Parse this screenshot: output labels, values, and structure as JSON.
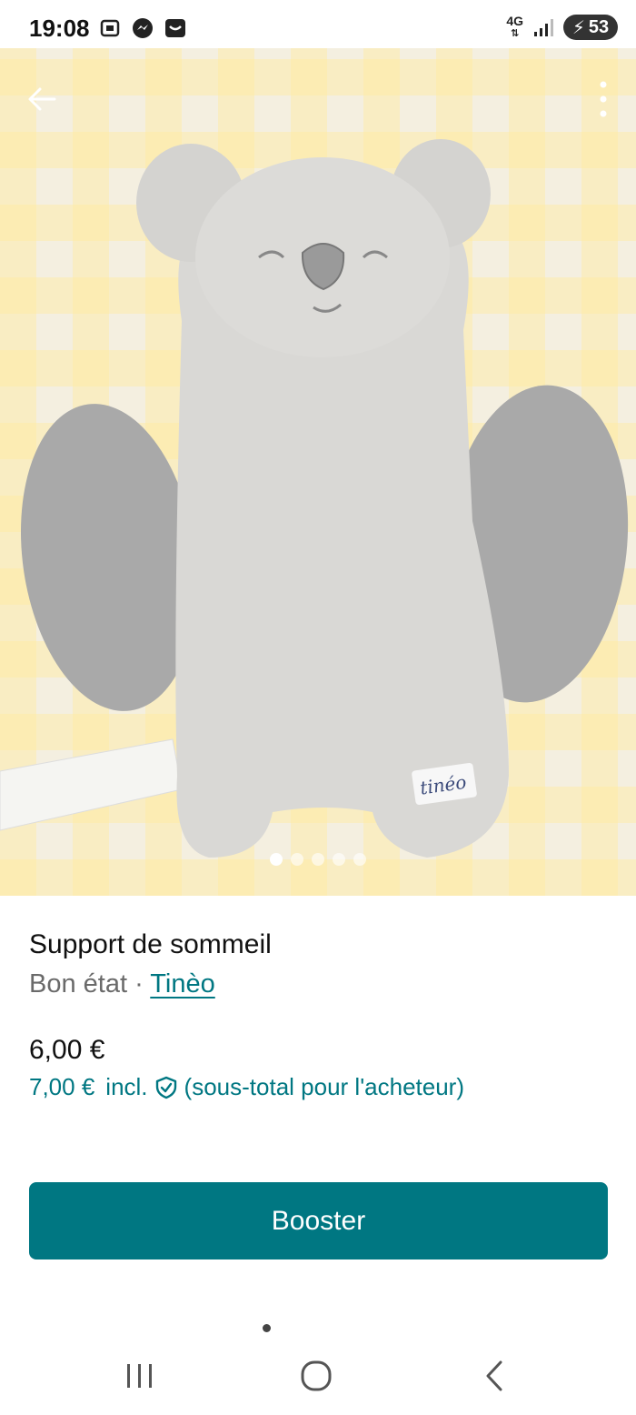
{
  "status_bar": {
    "time": "19:08",
    "network": "4G",
    "battery": "53",
    "icons_left": [
      "screenshot-icon",
      "messenger-icon",
      "inbox-icon"
    ],
    "icons_right": [
      "network-4g-icon",
      "signal-icon",
      "battery-charging-icon"
    ]
  },
  "photo": {
    "image_count": 5,
    "active_index": 0,
    "label_text": "tinéo"
  },
  "listing": {
    "title": "Support de sommeil",
    "condition": "Bon état",
    "separator": " · ",
    "brand": "Tinèo",
    "price": "6,00 €",
    "buyer_price": "7,00 €",
    "buyer_incl": "incl.",
    "buyer_note": "(sous-total pour l'acheteur)"
  },
  "actions": {
    "booster_label": "Booster"
  },
  "colors": {
    "accent": "#007782",
    "text": "#111111",
    "muted": "#6a6a6a"
  },
  "nav": [
    "recent-apps-icon",
    "home-icon",
    "back-icon"
  ]
}
